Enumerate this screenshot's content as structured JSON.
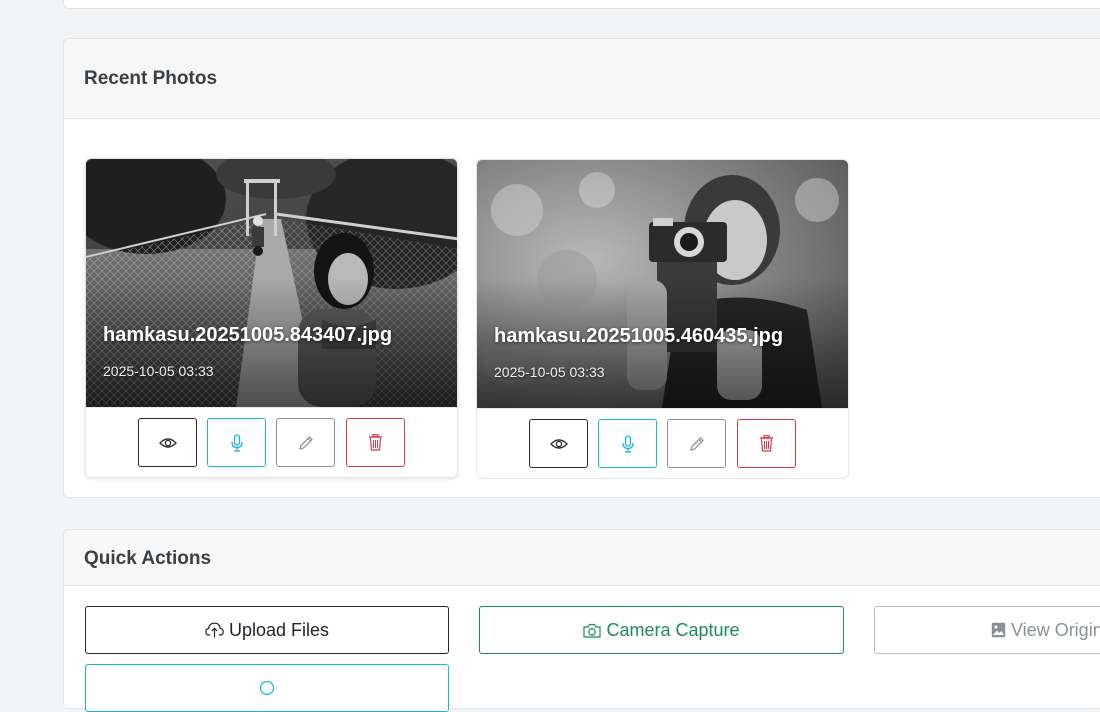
{
  "recent": {
    "title": "Recent Photos",
    "photos": [
      {
        "filename": "hamkasu.20251005.843407.jpg",
        "date": "2025-10-05 03:33"
      },
      {
        "filename": "hamkasu.20251005.460435.jpg",
        "date": "2025-10-05 03:33"
      }
    ],
    "action_icons": [
      "eye-icon",
      "microphone-icon",
      "pencil-icon",
      "trash-icon"
    ]
  },
  "quick_actions": {
    "title": "Quick Actions",
    "upload_label": "Upload Files",
    "camera_label": "Camera Capture",
    "original_label": "View Origin",
    "upload_icon": "cloud-upload-icon",
    "camera_icon": "camera-icon",
    "original_icon": "image-icon"
  },
  "colors": {
    "info": "#17b8d6",
    "success": "#1d8a5a",
    "danger": "#d23a4a",
    "secondary": "#8a8f94",
    "dark": "#2a2a2a"
  }
}
